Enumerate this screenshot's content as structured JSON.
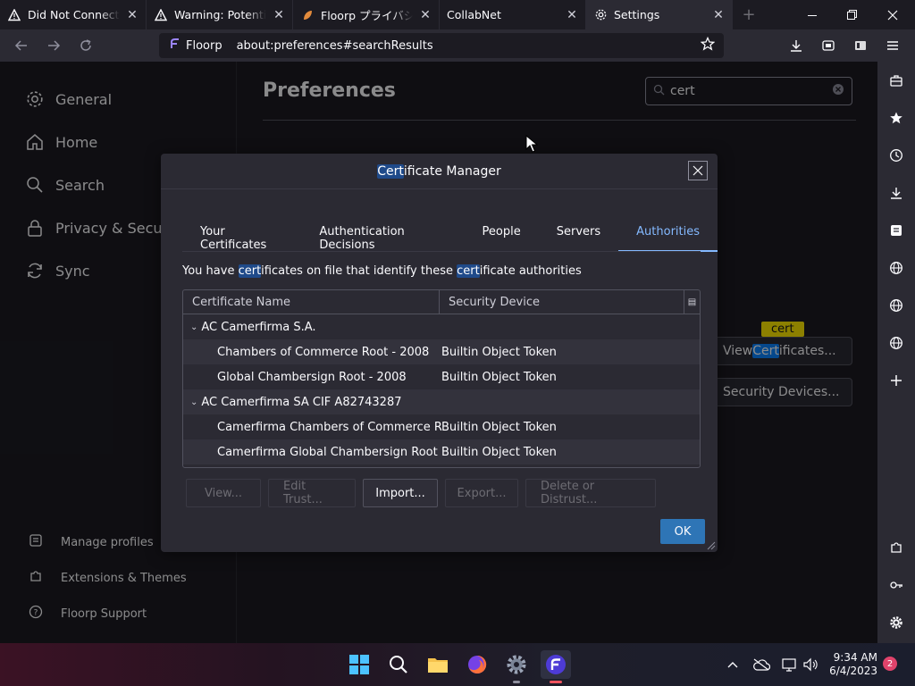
{
  "tabs": [
    {
      "title": "Did Not Connect: Potential Security Issue",
      "icon": "warning-icon",
      "active": false
    },
    {
      "title": "Warning: Potential Security Risk Ahead",
      "icon": "warning-icon",
      "active": false
    },
    {
      "title": "Floorp プライバシーポリシー",
      "icon": "floorp-leaf-icon",
      "active": false
    },
    {
      "title": "CollabNet",
      "icon": "",
      "active": false
    },
    {
      "title": "Settings",
      "icon": "gear-icon",
      "active": true
    }
  ],
  "urlbar": {
    "identity": "Floorp",
    "url": "about:preferences#searchResults"
  },
  "prefs": {
    "title": "Preferences",
    "search_value": "cert",
    "categories": [
      {
        "label": "General",
        "icon": "gear-icon"
      },
      {
        "label": "Home",
        "icon": "home-icon"
      },
      {
        "label": "Search",
        "icon": "search-icon"
      },
      {
        "label": "Privacy & Security",
        "icon": "lock-icon"
      },
      {
        "label": "Sync",
        "icon": "sync-icon"
      }
    ],
    "footer": [
      {
        "label": "Manage profiles",
        "icon": "profiles-icon"
      },
      {
        "label": "Extensions & Themes",
        "icon": "puzzle-icon"
      },
      {
        "label": "Floorp Support",
        "icon": "help-icon"
      }
    ],
    "view_certs_pre": "View ",
    "view_certs_hl": "Cert",
    "view_certs_post": "ificates...",
    "security_devices": "Security Devices...",
    "tooltip": "cert"
  },
  "dialog": {
    "title_hl": "Cert",
    "title_rest": "ificate Manager",
    "tabs": [
      "Your Certificates",
      "Authentication Decisions",
      "People",
      "Servers",
      "Authorities"
    ],
    "active_tab": "Authorities",
    "desc_1": "You have ",
    "desc_hl1": "cert",
    "desc_2": "ificates on file that identify these ",
    "desc_hl2": "cert",
    "desc_3": "ificate authorities",
    "columns": [
      "Certificate Name",
      "Security Device"
    ],
    "rows": [
      {
        "type": "group",
        "name": "AC Camerfirma S.A.",
        "device": ""
      },
      {
        "type": "child",
        "name": "Chambers of Commerce Root - 2008",
        "device": "Builtin Object Token"
      },
      {
        "type": "child",
        "name": "Global Chambersign Root - 2008",
        "device": "Builtin Object Token"
      },
      {
        "type": "group",
        "name": "AC Camerfirma SA CIF A82743287",
        "device": ""
      },
      {
        "type": "child",
        "name": "Camerfirma Chambers of Commerce Root",
        "device": "Builtin Object Token"
      },
      {
        "type": "child",
        "name": "Camerfirma Global Chambersign Root",
        "device": "Builtin Object Token"
      }
    ],
    "buttons": [
      {
        "label": "View...",
        "enabled": false
      },
      {
        "label": "Edit Trust...",
        "enabled": false
      },
      {
        "label": "Import...",
        "enabled": true
      },
      {
        "label": "Export...",
        "enabled": false
      },
      {
        "label": "Delete or Distrust...",
        "enabled": false
      }
    ],
    "ok": "OK"
  },
  "taskbar": {
    "time": "9:34 AM",
    "date": "6/4/2023",
    "notifications": "2"
  },
  "colors": {
    "accent": "#0a84ff",
    "highlight": "#ffe900"
  }
}
